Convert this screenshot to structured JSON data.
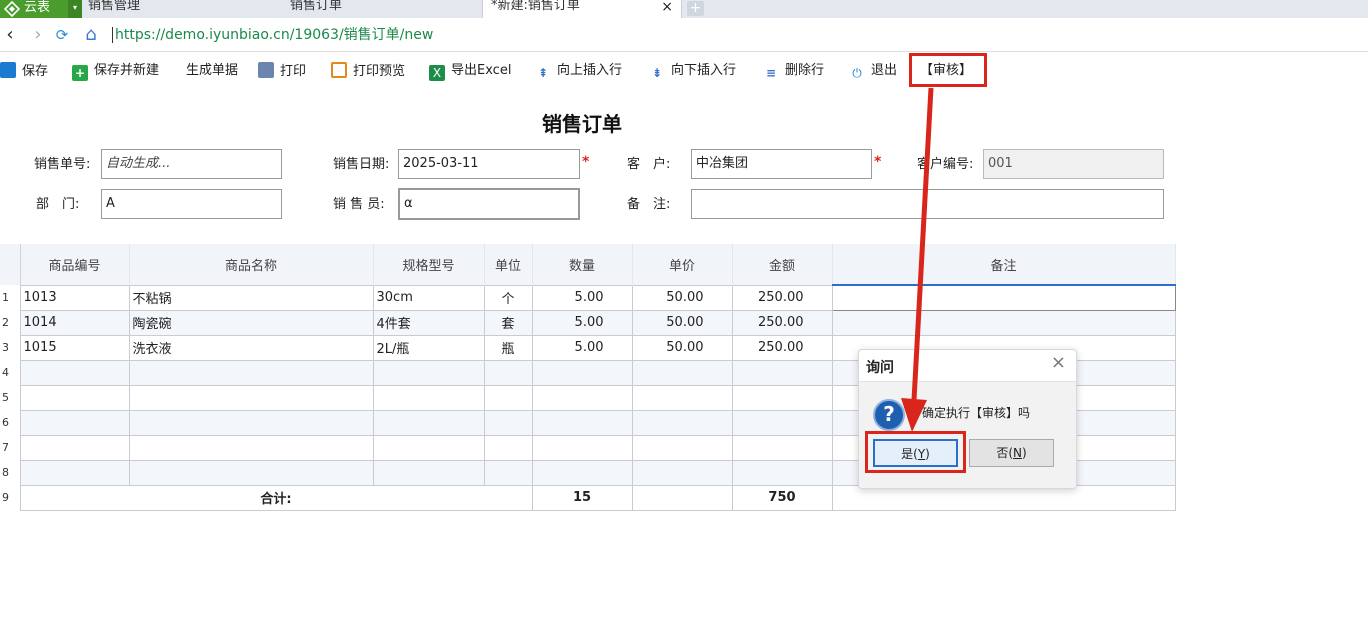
{
  "browser": {
    "app_tab": {
      "label": "云表"
    },
    "tabs": [
      {
        "label": "销售管理"
      },
      {
        "label": "销售订单"
      },
      {
        "label": "*新建:销售订单"
      }
    ],
    "url": "https://demo.iyunbiao.cn/19063/销售订单/new"
  },
  "toolbar": {
    "save": "保存",
    "save_new": "保存并新建",
    "gen_doc": "生成单据",
    "print": "打印",
    "print_preview": "打印预览",
    "export_excel": "导出Excel",
    "insert_up": "向上插入行",
    "insert_down": "向下插入行",
    "delete_row": "删除行",
    "exit": "退出",
    "audit": "【审核】"
  },
  "form": {
    "title": "销售订单",
    "order_no": {
      "label": "销售单号:",
      "placeholder": "自动生成..."
    },
    "order_date": {
      "label": "销售日期:",
      "value": "2025-03-11"
    },
    "customer": {
      "label": "客　户:",
      "value": "中冶集团"
    },
    "customer_no": {
      "label": "客户编号:",
      "value": "001"
    },
    "department": {
      "label": "部　门:",
      "value": "A"
    },
    "salesperson": {
      "label": "销 售 员:",
      "value": "α"
    },
    "remark": {
      "label": "备　注:",
      "value": ""
    },
    "required_mark": "*"
  },
  "table": {
    "columns": [
      "商品编号",
      "商品名称",
      "规格型号",
      "单位",
      "数量",
      "单价",
      "金额",
      "备注"
    ],
    "rows": [
      {
        "n": "1",
        "code": "1013",
        "name": "不粘锅",
        "spec": "30cm",
        "unit": "个",
        "qty": "5.00",
        "price": "50.00",
        "amount": "250.00",
        "note": ""
      },
      {
        "n": "2",
        "code": "1014",
        "name": "陶瓷碗",
        "spec": "4件套",
        "unit": "套",
        "qty": "5.00",
        "price": "50.00",
        "amount": "250.00",
        "note": ""
      },
      {
        "n": "3",
        "code": "1015",
        "name": "洗衣液",
        "spec": "2L/瓶",
        "unit": "瓶",
        "qty": "5.00",
        "price": "50.00",
        "amount": "250.00",
        "note": ""
      },
      {
        "n": "4"
      },
      {
        "n": "5"
      },
      {
        "n": "6"
      },
      {
        "n": "7"
      },
      {
        "n": "8"
      }
    ],
    "total": {
      "n": "9",
      "label": "合计:",
      "qty": "15",
      "amount": "750"
    }
  },
  "dialog": {
    "title": "询问",
    "message": "确定执行【审核】吗",
    "yes": "是",
    "yes_key": "Y",
    "no": "否",
    "no_key": "N"
  },
  "colors": {
    "highlight": "#d9261c",
    "accent": "#2a6fc9",
    "brand": "#4a9c2d"
  }
}
